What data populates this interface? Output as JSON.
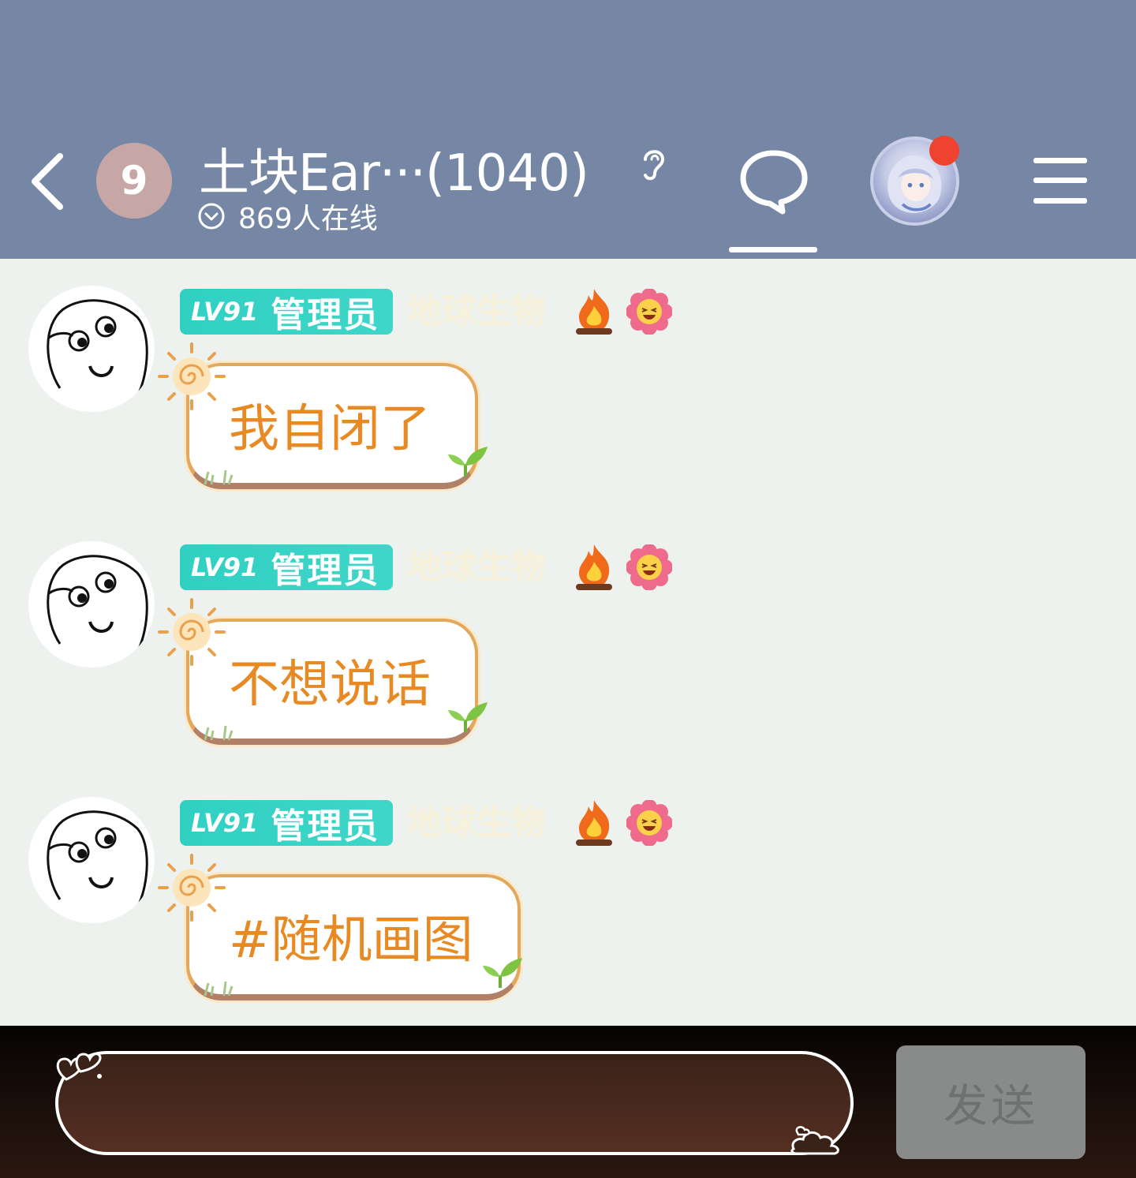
{
  "header": {
    "badge": "9",
    "title": "土块Ear···(1040)",
    "online": "869人在线",
    "colors": {
      "bar": "#7687a6",
      "notification": "#f0432f"
    }
  },
  "messages": [
    {
      "level": "LV91",
      "role": "管理员",
      "title_tag": "地球生物",
      "text": "我自闭了"
    },
    {
      "level": "LV91",
      "role": "管理员",
      "title_tag": "地球生物",
      "text": "不想说话"
    },
    {
      "level": "LV91",
      "role": "管理员",
      "title_tag": "地球生物",
      "text": "#随机画图"
    }
  ],
  "input": {
    "value": "",
    "placeholder": ""
  },
  "send_label": "发送",
  "icons": [
    "back-icon",
    "ear-icon",
    "chevron-down-icon",
    "chat-bubble-icon",
    "menu-icon",
    "fire-icon",
    "flower-emoji-icon",
    "sun-icon",
    "leaf-icon",
    "heart-icon",
    "cloud-icon"
  ]
}
